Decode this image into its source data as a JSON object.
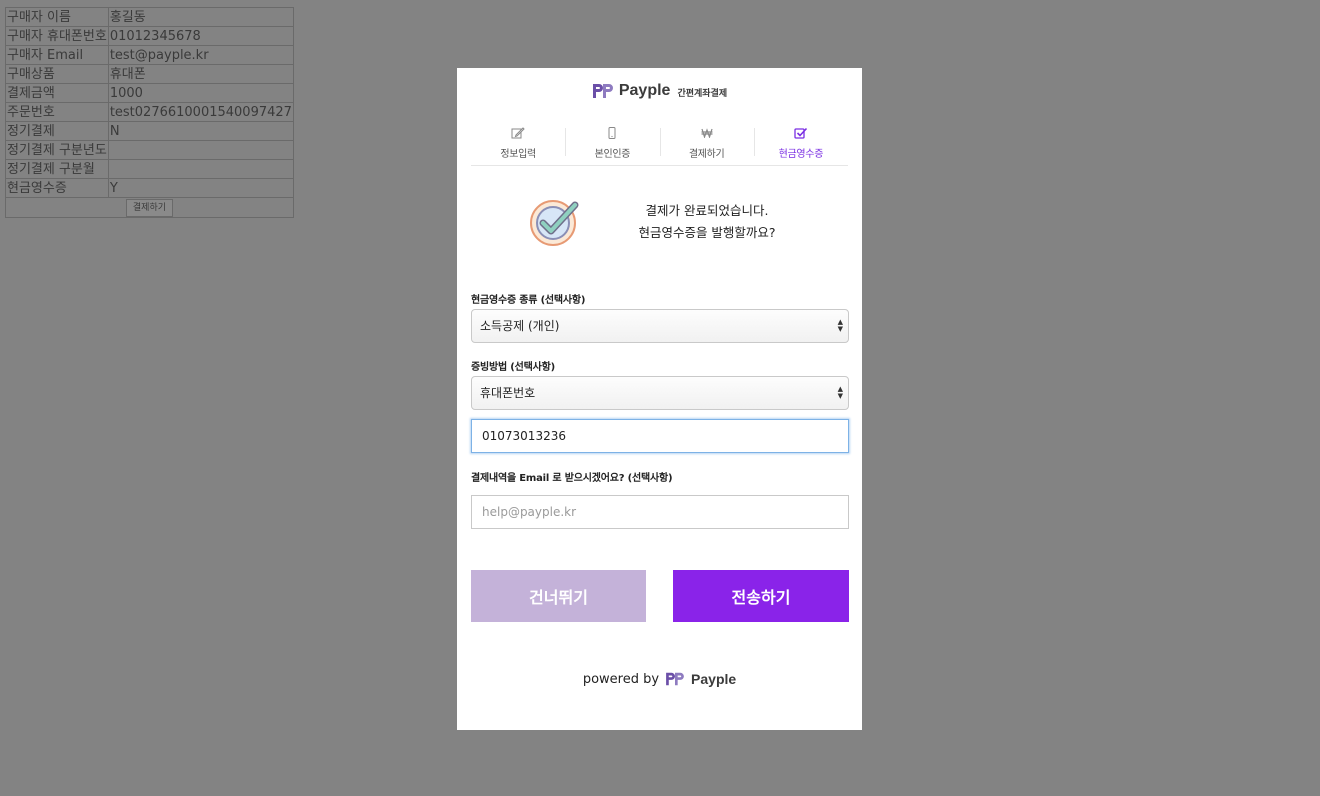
{
  "order": {
    "rows": [
      {
        "label": "구매자 이름",
        "value": "홍길동"
      },
      {
        "label": "구매자 휴대폰번호",
        "value": "01012345678"
      },
      {
        "label": "구매자 Email",
        "value": "test@payple.kr"
      },
      {
        "label": "구매상품",
        "value": "휴대폰"
      },
      {
        "label": "결제금액",
        "value": "1000"
      },
      {
        "label": "주문번호",
        "value": "test0276610001540097427"
      },
      {
        "label": "정기결제",
        "value": "N"
      },
      {
        "label": "정기결제 구분년도",
        "value": ""
      },
      {
        "label": "정기결제 구분월",
        "value": ""
      },
      {
        "label": "현금영수증",
        "value": "Y"
      }
    ],
    "pay_button": "결제하기"
  },
  "brand": {
    "name": "Payple",
    "subtitle": "간편계좌결제",
    "color": "#6b4fa8"
  },
  "steps": [
    {
      "label": "정보입력",
      "icon": "edit-icon"
    },
    {
      "label": "본인인증",
      "icon": "phone-icon"
    },
    {
      "label": "결제하기",
      "icon": "won-icon"
    },
    {
      "label": "현금영수증",
      "icon": "checkbox-icon",
      "active": true
    }
  ],
  "complete": {
    "line1": "결제가 완료되었습니다.",
    "line2": "현금영수증을 발행할까요?"
  },
  "form": {
    "receipt_type_label": "현금영수증 종류 (선택사항)",
    "receipt_type_value": "소득공제 (개인)",
    "proof_method_label": "증빙방법 (선택사항)",
    "proof_method_value": "휴대폰번호",
    "phone_value": "01073013236",
    "email_label": "결제내역을 Email 로 받으시겠어요? (선택사항)",
    "email_placeholder": "help@payple.kr"
  },
  "buttons": {
    "skip": "건너뛰기",
    "send": "전송하기"
  },
  "footer": {
    "powered_by": "powered by",
    "brand": "Payple"
  },
  "colors": {
    "accent": "#8a23e9",
    "skip": "#c4b2d9",
    "active_step": "#7a2ee3"
  }
}
